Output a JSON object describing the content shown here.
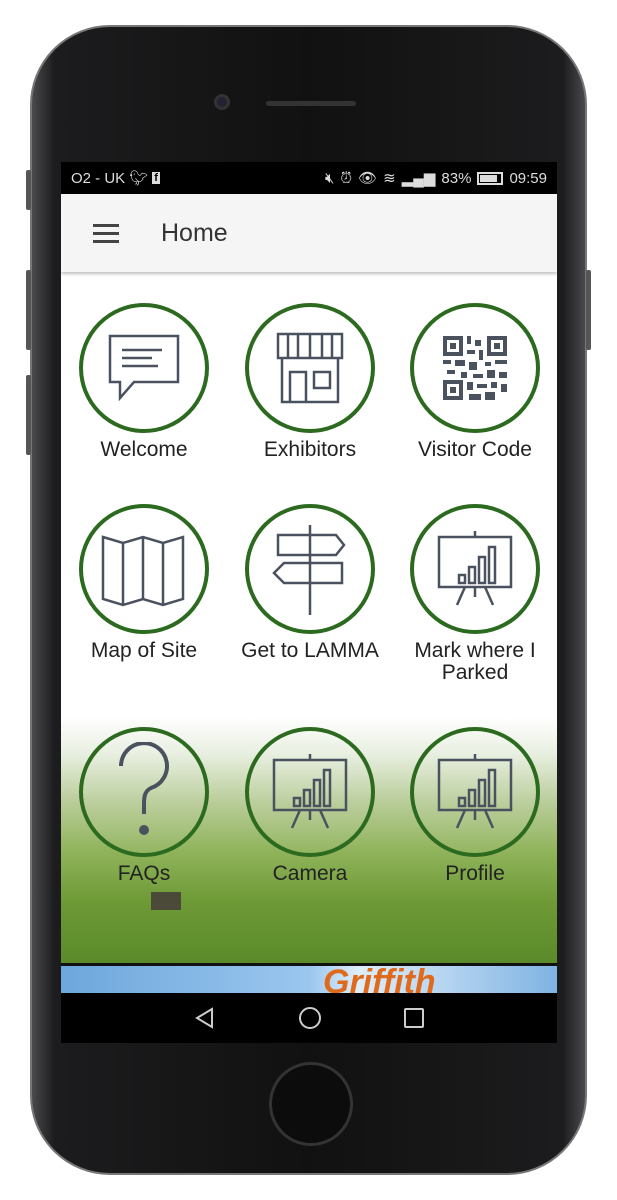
{
  "status_bar": {
    "carrier": "O2 - UK",
    "battery": "83%",
    "time": "09:59",
    "icons": [
      "twitter-icon",
      "facebook-icon",
      "mute-icon",
      "alarm-icon",
      "eye-icon",
      "wifi-icon",
      "signal-icon",
      "battery-icon"
    ]
  },
  "app_bar": {
    "title": "Home",
    "menu_icon": "hamburger-icon"
  },
  "tiles": [
    {
      "label": "Welcome",
      "icon": "chat-bubble-icon"
    },
    {
      "label": "Exhibitors",
      "icon": "storefront-icon"
    },
    {
      "label": "Visitor Code",
      "icon": "qr-code-icon"
    },
    {
      "label": "Map of Site",
      "icon": "folded-map-icon"
    },
    {
      "label": "Get to LAMMA",
      "icon": "signpost-icon"
    },
    {
      "label": "Mark where I Parked",
      "icon": "presentation-chart-icon"
    },
    {
      "label": "FAQs",
      "icon": "question-mark-icon"
    },
    {
      "label": "Camera",
      "icon": "presentation-chart-icon"
    },
    {
      "label": "Profile",
      "icon": "presentation-chart-icon"
    }
  ],
  "ad_banner": {
    "text": "Griffith"
  },
  "colors": {
    "circle": "#2c6b1f",
    "appbar": "#f5f5f5"
  }
}
